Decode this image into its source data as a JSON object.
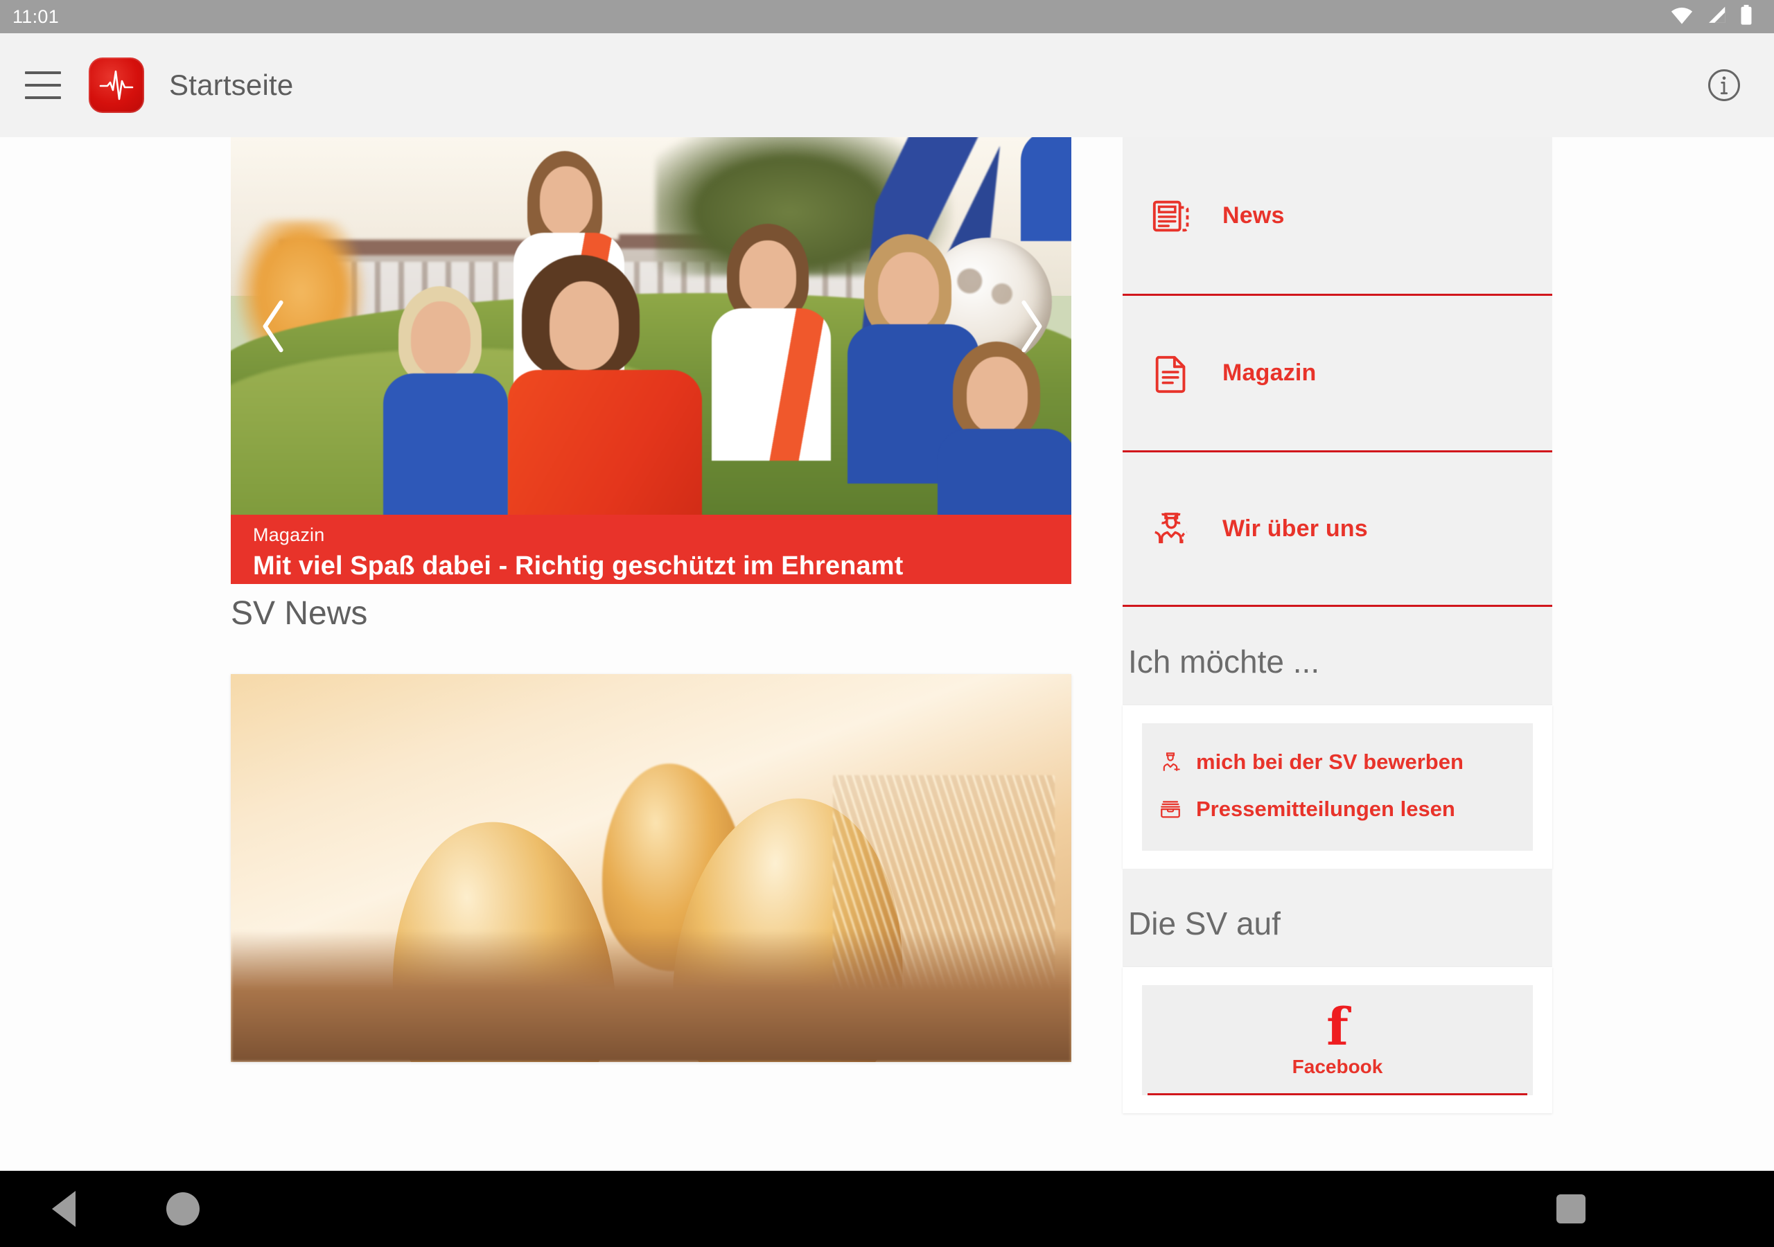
{
  "status_bar": {
    "clock": "11:01",
    "icons": [
      "wifi-icon",
      "cellular-signal-icon",
      "battery-icon"
    ]
  },
  "app_bar": {
    "menu_icon": "hamburger-menu-icon",
    "logo_icon": "sv-pulse-logo-icon",
    "title": "Startseite",
    "info_icon": "info-circle-icon"
  },
  "hero": {
    "prev_icon": "chevron-left-icon",
    "next_icon": "chevron-right-icon",
    "category": "Magazin",
    "headline": "Mit viel Spaß dabei - Richtig geschützt im Ehrenamt",
    "image_alt": "Jugendliche Sportmannschaft mit Trainer auf Rasen",
    "banner_color": "#e8332a"
  },
  "news_section": {
    "heading": "SV News",
    "card_image_alt": "Goldene Eier im Nest"
  },
  "quick_nav": {
    "items": [
      {
        "label": "News",
        "icon": "newspaper-icon"
      },
      {
        "label": "Magazin",
        "icon": "document-text-icon"
      },
      {
        "label": "Wir über uns",
        "icon": "people-group-icon"
      }
    ],
    "divider_color": "#d1161c",
    "accent_color": "#e8332a"
  },
  "wishes": {
    "heading": "Ich möchte ...",
    "items": [
      {
        "label": "mich bei der SV bewerben",
        "icon": "applicant-person-icon"
      },
      {
        "label": "Pressemitteilungen lesen",
        "icon": "press-tray-icon"
      }
    ]
  },
  "social": {
    "heading": "Die SV auf",
    "items": [
      {
        "label": "Facebook",
        "icon": "facebook-f-icon",
        "glyph": "f"
      }
    ]
  },
  "nav_bar": {
    "back_icon": "back-triangle-icon",
    "home_icon": "home-circle-icon",
    "recents_icon": "recents-square-icon"
  }
}
